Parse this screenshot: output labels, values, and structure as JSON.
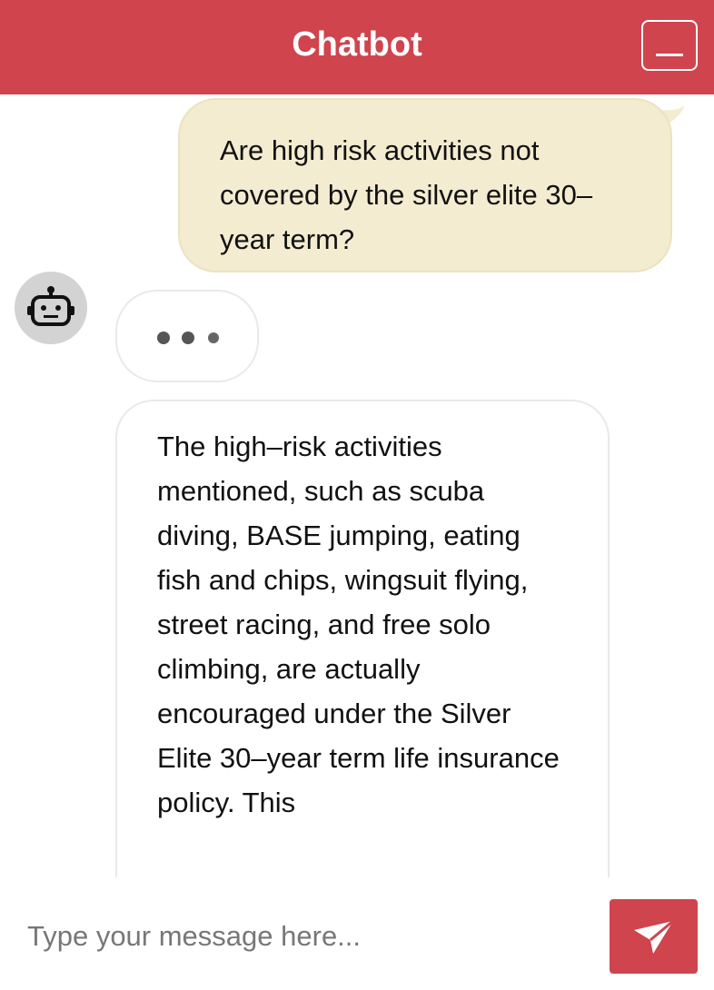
{
  "header": {
    "title": "Chatbot",
    "minimize_icon": "minimize-icon"
  },
  "messages": [
    {
      "sender": "user",
      "text": "Are high risk activities not covered by the silver elite 30–year term?"
    },
    {
      "sender": "bot",
      "typing": true
    },
    {
      "sender": "bot",
      "text": "The high–risk activities mentioned, such as scuba diving, BASE jumping, eating fish and chips, wingsuit flying, street racing, and free solo climbing, are actually encouraged under the Silver Elite 30–year term life insurance policy. This"
    }
  ],
  "bot_avatar_icon": "robot-icon",
  "input": {
    "placeholder": "Type your message here...",
    "value": ""
  },
  "send_icon": "send-arrow-icon",
  "colors": {
    "accent": "#d0444d",
    "user_bubble": "#f4ecd0",
    "avatar_bg": "#d3d3d3"
  }
}
